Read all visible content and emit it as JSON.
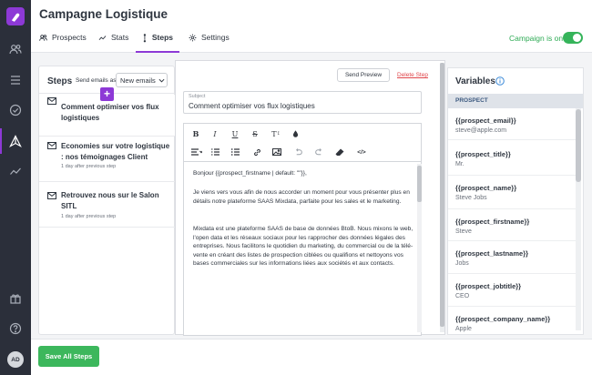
{
  "header": {
    "title": "Campagne Logistique",
    "tabs": [
      {
        "label": "Prospects",
        "icon": "users-icon"
      },
      {
        "label": "Stats",
        "icon": "trend-icon"
      },
      {
        "label": "Steps",
        "icon": "steps-icon",
        "active": true
      },
      {
        "label": "Settings",
        "icon": "gear-icon"
      }
    ],
    "campaign_status": "Campaign is on",
    "campaign_on": true
  },
  "sidebar": {
    "icons": [
      "users-icon",
      "list-icon",
      "check-circle-icon",
      "send-icon",
      "trend-icon",
      "gift-icon",
      "help-icon"
    ],
    "active": "send-icon",
    "avatar_initials": "AD"
  },
  "steps": {
    "title": "Steps",
    "send_emails_as_label": "Send emails as",
    "send_emails_as_value": "New emails",
    "items": [
      {
        "title": "Comment optimiser vos flux logistiques",
        "delay": ""
      },
      {
        "title": "Economies sur votre logistique : nos témoignages Client",
        "delay": "1 day after previous step"
      },
      {
        "title": "Retrouvez nous sur le Salon SITL",
        "delay": "1 day after previous step"
      }
    ]
  },
  "editor": {
    "send_preview": "Send Preview",
    "delete_step": "Delete Step",
    "subject_label": "Subject",
    "subject_value": "Comment optimiser vos flux logistiques",
    "body": [
      "Bonjour {{prospect_firstname | default: \"\"}},",
      "Je viens vers vous afin de nous accorder un moment pour vous présenter plus en détails notre plateforme SAAS Mixdata, parfaite pour les sales et le marketing.",
      "Mixdata est une plateforme SAAS de base de données BtoB. Nous mixons le web, l'open data et les réseaux sociaux pour les rapprocher des données légales des entreprises. Nous facilitons le quotidien du marketing, du commercial ou de la télé-vente en créant des listes de prospection ciblées ou qualifions et nettoyons vos bases commerciales sur les informations liées aux sociétés et aux contacts."
    ],
    "toolbar": [
      "bold-icon",
      "italic-icon",
      "underline-icon",
      "strikethrough-icon",
      "text-size-icon",
      "color-drop-icon",
      "align-icon",
      "ordered-list-icon",
      "bullet-list-icon",
      "link-icon",
      "image-icon",
      "undo-icon",
      "redo-icon",
      "eraser-icon",
      "code-icon"
    ]
  },
  "variables": {
    "title": "Variables",
    "section": "PROSPECT",
    "items": [
      {
        "name": "{{prospect_email}}",
        "value": "steve@apple.com"
      },
      {
        "name": "{{prospect_title}}",
        "value": "Mr."
      },
      {
        "name": "{{prospect_name}}",
        "value": "Steve Jobs"
      },
      {
        "name": "{{prospect_firstname}}",
        "value": "Steve"
      },
      {
        "name": "{{prospect_lastname}}",
        "value": "Jobs"
      },
      {
        "name": "{{prospect_jobtitle}}",
        "value": "CEO"
      },
      {
        "name": "{{prospect_company_name}}",
        "value": "Apple"
      }
    ]
  },
  "footer": {
    "save_all": "Save All Steps"
  },
  "colors": {
    "accent": "#8d39d6",
    "success": "#3cb75c",
    "danger": "#e0474c",
    "sidebar": "#2b2f3a"
  }
}
